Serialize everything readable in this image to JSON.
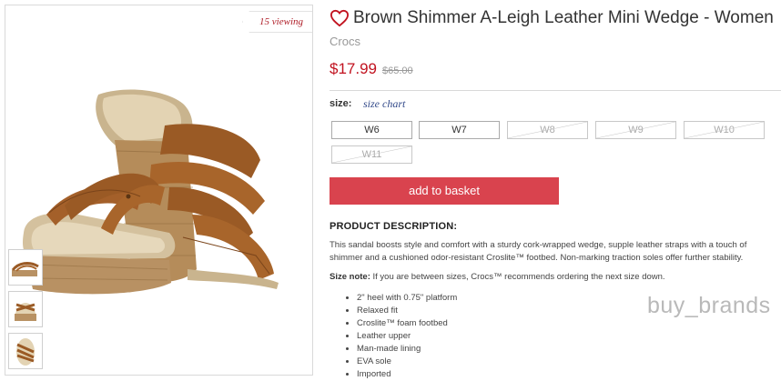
{
  "gallery": {
    "viewing_badge": "15 viewing",
    "main_image_alt": "Brown shimmer leather cork wedge sandals",
    "thumbnails": [
      "side-view",
      "front-view",
      "top-view"
    ]
  },
  "product": {
    "title": "Brown Shimmer A-Leigh Leather Mini Wedge - Women",
    "brand": "Crocs",
    "price": "$17.99",
    "original_price": "$65.00",
    "heart_icon": "heart-outline-icon",
    "accent_color": "#c1121f"
  },
  "sizes": {
    "label": "size:",
    "chart_link": "size chart",
    "options": [
      {
        "label": "W6",
        "available": true
      },
      {
        "label": "W7",
        "available": true
      },
      {
        "label": "W8",
        "available": false
      },
      {
        "label": "W9",
        "available": false
      },
      {
        "label": "W10",
        "available": false
      },
      {
        "label": "W11",
        "available": false
      }
    ]
  },
  "actions": {
    "add_to_basket": "add to basket",
    "button_color": "#d9434e"
  },
  "description": {
    "heading": "PRODUCT DESCRIPTION:",
    "line1": "This sandal boosts style and comfort with a sturdy cork-wrapped wedge, supple leather straps with a touch of",
    "line2": "shimmer and a cushioned odor-resistant Croslite™ footbed. Non-marking traction soles offer further stability.",
    "size_note_label": "Size note:",
    "size_note_text": " If you are between sizes, Crocs™ recommends ordering the next size down.",
    "features": [
      "2\" heel with 0.75\" platform",
      "Relaxed fit",
      "Croslite™ foam footbed",
      "Leather upper",
      "Man-made lining",
      "EVA sole",
      "Imported"
    ]
  },
  "watermark": "buy_brands"
}
